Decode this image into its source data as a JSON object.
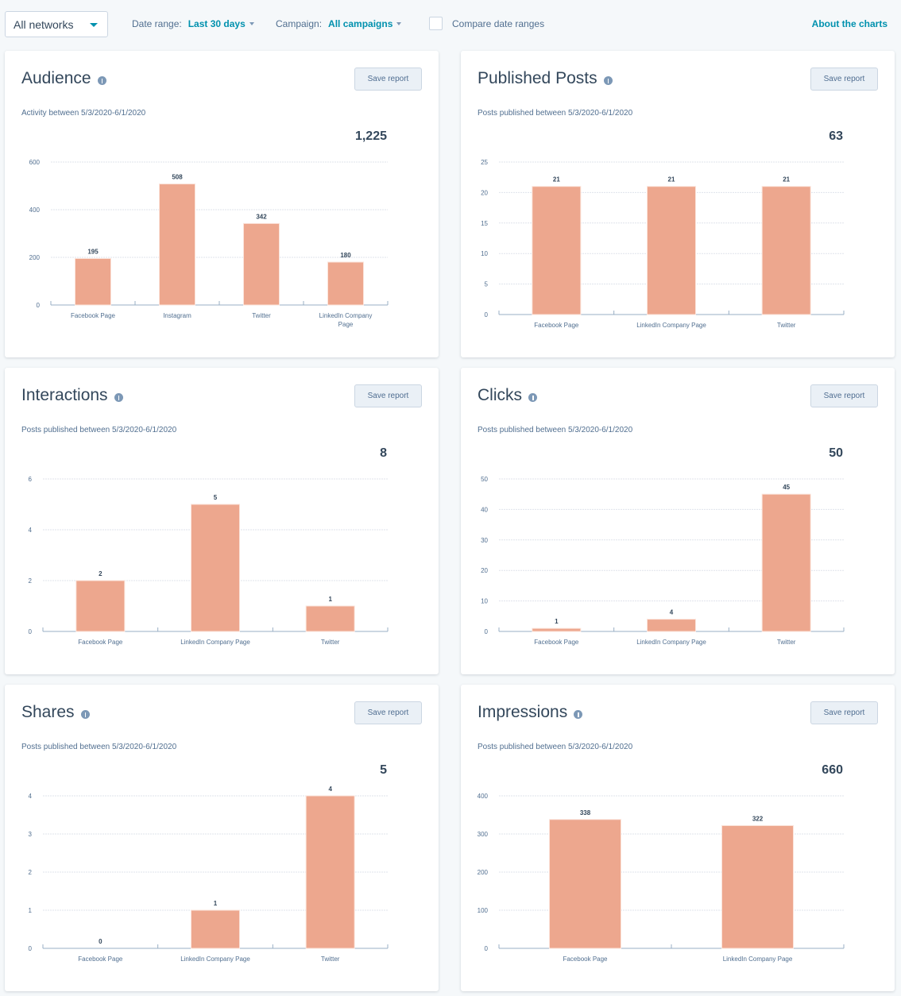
{
  "toolbar": {
    "network_select": "All networks",
    "date_range_label": "Date range:",
    "date_range_value": "Last 30 days",
    "campaign_label": "Campaign:",
    "campaign_value": "All campaigns",
    "compare_label": "Compare date ranges",
    "compare_checked": false,
    "about_link": "About the charts"
  },
  "colors": {
    "bar": "#eda78e",
    "accent": "#0091ae",
    "text": "#33475b"
  },
  "save_label": "Save report",
  "chart_data": [
    {
      "type": "bar",
      "title": "Audience",
      "subtitle": "Activity between 5/3/2020-6/1/2020",
      "total": "1,225",
      "categories": [
        "Facebook Page",
        "Instagram",
        "Twitter",
        "LinkedIn Company Page"
      ],
      "values": [
        195,
        508,
        342,
        180
      ],
      "yticks": [
        0,
        200,
        400,
        600
      ],
      "ylim": [
        0,
        600
      ],
      "xlabel": "",
      "ylabel": "",
      "grid": true
    },
    {
      "type": "bar",
      "title": "Published Posts",
      "subtitle": "Posts published between 5/3/2020-6/1/2020",
      "total": "63",
      "categories": [
        "Facebook Page",
        "LinkedIn Company Page",
        "Twitter"
      ],
      "values": [
        21,
        21,
        21
      ],
      "yticks": [
        0,
        5,
        10,
        15,
        20,
        25
      ],
      "ylim": [
        0,
        25
      ],
      "xlabel": "",
      "ylabel": "",
      "grid": true
    },
    {
      "type": "bar",
      "title": "Interactions",
      "subtitle": "Posts published between 5/3/2020-6/1/2020",
      "total": "8",
      "categories": [
        "Facebook Page",
        "LinkedIn Company Page",
        "Twitter"
      ],
      "values": [
        2,
        5,
        1
      ],
      "yticks": [
        0,
        2,
        4,
        6
      ],
      "ylim": [
        0,
        6
      ],
      "xlabel": "",
      "ylabel": "",
      "grid": true
    },
    {
      "type": "bar",
      "title": "Clicks",
      "subtitle": "Posts published between 5/3/2020-6/1/2020",
      "total": "50",
      "categories": [
        "Facebook Page",
        "LinkedIn Company Page",
        "Twitter"
      ],
      "values": [
        1,
        4,
        45
      ],
      "yticks": [
        0,
        10,
        20,
        30,
        40,
        50
      ],
      "ylim": [
        0,
        50
      ],
      "xlabel": "",
      "ylabel": "",
      "grid": true
    },
    {
      "type": "bar",
      "title": "Shares",
      "subtitle": "Posts published between 5/3/2020-6/1/2020",
      "total": "5",
      "categories": [
        "Facebook Page",
        "LinkedIn Company Page",
        "Twitter"
      ],
      "values": [
        0,
        1,
        4
      ],
      "yticks": [
        0,
        1,
        2,
        3,
        4
      ],
      "ylim": [
        0,
        4
      ],
      "xlabel": "",
      "ylabel": "",
      "grid": true
    },
    {
      "type": "bar",
      "title": "Impressions",
      "subtitle": "Posts published between 5/3/2020-6/1/2020",
      "total": "660",
      "categories": [
        "Facebook Page",
        "LinkedIn Company Page"
      ],
      "values": [
        338,
        322
      ],
      "yticks": [
        0,
        100,
        200,
        300,
        400
      ],
      "ylim": [
        0,
        400
      ],
      "xlabel": "",
      "ylabel": "",
      "grid": true
    }
  ]
}
